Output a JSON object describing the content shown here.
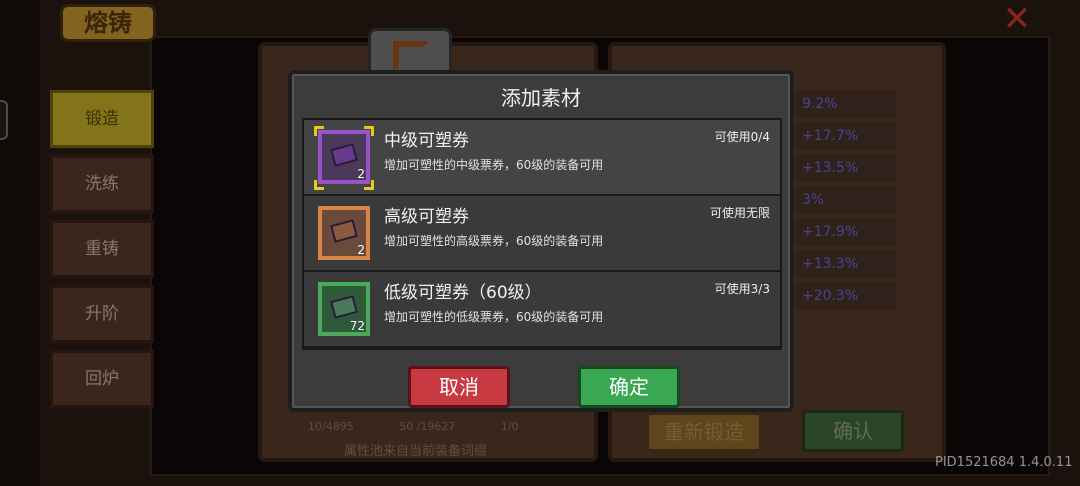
{
  "header": {
    "title": "熔铸"
  },
  "sidebar": {
    "tabs": [
      {
        "label": "锻造",
        "active": true
      },
      {
        "label": "洗练",
        "active": false
      },
      {
        "label": "重铸",
        "active": false
      },
      {
        "label": "升阶",
        "active": false
      },
      {
        "label": "回炉",
        "active": false
      }
    ]
  },
  "background": {
    "stats": [
      "9.2%",
      "+17.7%",
      "+13.5%",
      "3%",
      "+17.9%",
      "+13.3%",
      "+20.3%"
    ],
    "counts": [
      "10/4895",
      "50 /19627",
      "1/0"
    ],
    "pool_note": "属性池来自当前装备词缀",
    "reforge_label": "重新锻造",
    "confirm_label": "确认"
  },
  "modal": {
    "title": "添加素材",
    "items": [
      {
        "name": "中级可塑券",
        "availability": "可使用0/4",
        "description": "增加可塑性的中级票券，60级的装备可用",
        "qty": "2",
        "rarity": "purple",
        "selected": true
      },
      {
        "name": "高级可塑券",
        "availability": "可使用无限",
        "description": "增加可塑性的高级票券，60级的装备可用",
        "qty": "2",
        "rarity": "orange",
        "selected": false
      },
      {
        "name": "低级可塑券（60级）",
        "availability": "可使用3/3",
        "description": "增加可塑性的低级票券，60级的装备可用",
        "qty": "72",
        "rarity": "green",
        "selected": false
      }
    ],
    "cancel_label": "取消",
    "ok_label": "确定"
  },
  "footer": {
    "pid": "PID1521684 1.4.0.11"
  },
  "colors": {
    "purple": "#9a52c8",
    "orange": "#d9844a",
    "green": "#4aaa5a",
    "cancel": "#c83a42",
    "ok": "#3aa852",
    "selected": "#e8c81a"
  }
}
